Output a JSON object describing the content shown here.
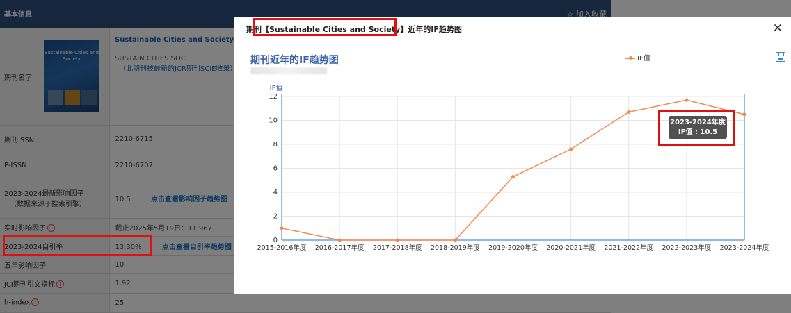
{
  "background": {
    "header_label": "基本信息",
    "fav_label": "☆ 加入收藏",
    "rows": [
      {
        "label": "期刊名字",
        "journal_title": "Sustainable Cities and Society",
        "abbr": "SUSTAIN CITIES SOC",
        "note": "（此期刊被最新的JCR期刊SCIE收录）",
        "cover_text": "Sustainable Cities and Society"
      },
      {
        "label": "期刊ISSN",
        "value": "2210-6715"
      },
      {
        "label": "P-ISSN",
        "value": "2210-6707"
      },
      {
        "label": "2023-2024最新影响因子",
        "sublabel": "（数据来源于搜索引擎）",
        "value": "10.5",
        "link": "点击查看影响因子趋势图"
      },
      {
        "label": "实时影响因子",
        "value": "截止2025年5月19日：11.967"
      },
      {
        "label": "2023-2024自引率",
        "value": "13.30%",
        "link": "点击查看自引率趋势图"
      },
      {
        "label": "五年影响因子",
        "value": "10"
      },
      {
        "label": "JCI期刊引文指标",
        "value": "1.92"
      },
      {
        "label": "h-index",
        "value": "25"
      }
    ]
  },
  "modal": {
    "title": "期刊【Sustainable Cities and Society】近年的IF趋势图",
    "close_icon": "close-icon",
    "chart_title": "期刊近年的IF趋势图",
    "legend_label": "IF值",
    "save_icon": "save-icon",
    "tooltip": {
      "line1": "2023-2024年度",
      "line2": "IF值 : 10.5"
    }
  },
  "chart_data": {
    "type": "line",
    "ylabel": "IF值",
    "categories": [
      "2015-2016年度",
      "2016-2017年度",
      "2017-2018年度",
      "2018-2019年度",
      "2019-2020年度",
      "2020-2021年度",
      "2021-2022年度",
      "2022-2023年度",
      "2023-2024年度"
    ],
    "series": [
      {
        "name": "IF值",
        "values": [
          1.0,
          0,
          0,
          0,
          5.3,
          7.6,
          10.7,
          11.7,
          10.5
        ]
      }
    ],
    "ylim": [
      0,
      12
    ],
    "yticks": [
      0,
      2,
      4,
      6,
      8,
      10,
      12
    ],
    "line_color": "#f4884f",
    "grid": true
  },
  "colors": {
    "header_bg": "#2a4d7b",
    "accent": "#3a63a6",
    "highlight": "#e01010"
  }
}
